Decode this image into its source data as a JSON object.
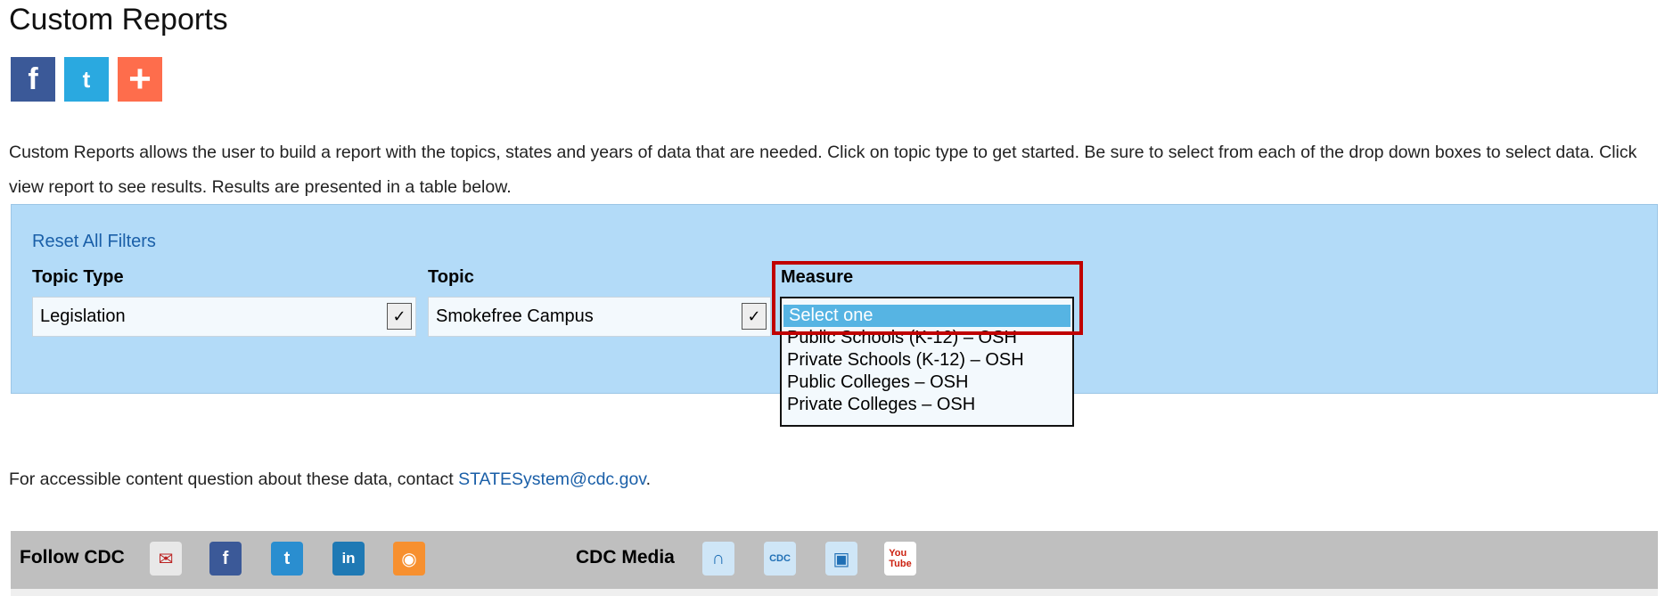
{
  "page": {
    "title": "Custom Reports",
    "intro": "Custom Reports allows the user to build a report with the topics, states and years of data that are needed. Click on topic type to get started. Be sure to select from each of the drop down boxes to select data. Click view report to see results. Results are presented in a table below."
  },
  "share": [
    {
      "name": "facebook",
      "glyph": "f",
      "color": "#3b5998"
    },
    {
      "name": "twitter",
      "glyph": "🐦",
      "color": "#2aa9e0"
    },
    {
      "name": "addthis",
      "glyph": "+",
      "color": "#fe6d4c"
    }
  ],
  "filters": {
    "reset": "Reset All Filters",
    "topic_type_label": "Topic Type",
    "topic_type_value": "Legislation",
    "topic_label": "Topic",
    "topic_value": "Smokefree Campus",
    "measure_label": "Measure",
    "measure_options": [
      "Select one",
      "Public Schools (K-12) – OSH",
      "Private Schools (K-12) – OSH",
      "Public Colleges – OSH",
      "Private Colleges – OSH"
    ]
  },
  "contact": {
    "text": "For accessible content question about these data, contact ",
    "email": "STATESystem@cdc.gov",
    "end": "."
  },
  "footer": {
    "follow": "Follow CDC",
    "media": "CDC Media"
  }
}
